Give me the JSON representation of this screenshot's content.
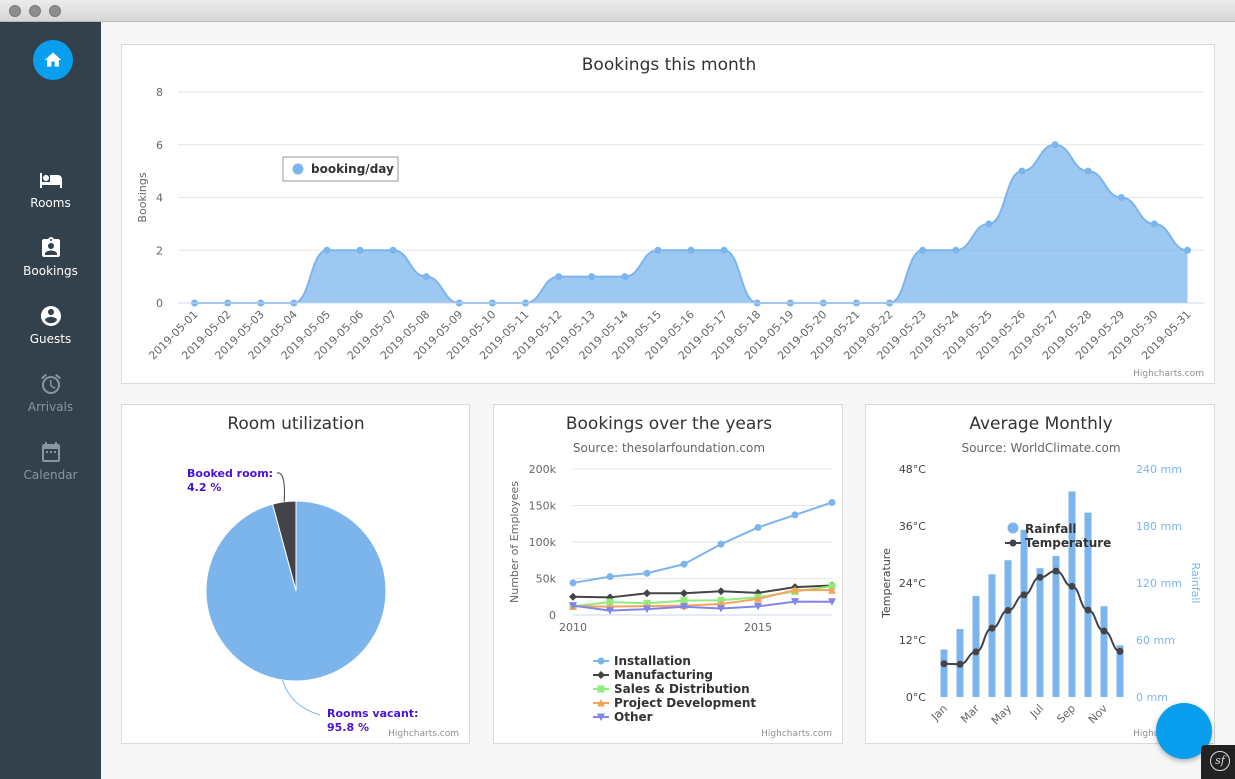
{
  "window": {
    "controls": [
      "close",
      "minimize",
      "maximize"
    ]
  },
  "sidebar": {
    "home_icon": "home-icon",
    "items": [
      {
        "label": "Rooms",
        "icon": "bed-icon",
        "active": true
      },
      {
        "label": "Bookings",
        "icon": "clipboard-icon",
        "active": true
      },
      {
        "label": "Guests",
        "icon": "account-circle-icon",
        "active": true
      },
      {
        "label": "Arrivals",
        "icon": "alarm-clock-icon",
        "active": false
      },
      {
        "label": "Calendar",
        "icon": "calendar-icon",
        "active": false
      }
    ]
  },
  "credit": "Highcharts.com",
  "colors": {
    "sidebar": "#33414c",
    "accent": "#0a9eef",
    "series_blue": "#7cb5ec",
    "dark": "#434348",
    "green": "#90ed7d",
    "orange": "#f7a35c",
    "purple": "#8085e9"
  },
  "chart_data": [
    {
      "id": "bookings_month",
      "type": "area",
      "title": "Bookings this month",
      "ylabel": "Bookings",
      "ylim": [
        0,
        8
      ],
      "yticks": [
        0,
        2,
        4,
        6,
        8
      ],
      "grid": true,
      "legend_placement": "top-left",
      "categories": [
        "2019-05-01",
        "2019-05-02",
        "2019-05-03",
        "2019-05-04",
        "2019-05-05",
        "2019-05-06",
        "2019-05-07",
        "2019-05-08",
        "2019-05-09",
        "2019-05-10",
        "2019-05-11",
        "2019-05-12",
        "2019-05-13",
        "2019-05-14",
        "2019-05-15",
        "2019-05-16",
        "2019-05-17",
        "2019-05-18",
        "2019-05-19",
        "2019-05-20",
        "2019-05-21",
        "2019-05-22",
        "2019-05-23",
        "2019-05-24",
        "2019-05-25",
        "2019-05-26",
        "2019-05-27",
        "2019-05-28",
        "2019-05-29",
        "2019-05-30",
        "2019-05-31"
      ],
      "series": [
        {
          "name": "booking/day",
          "values": [
            0,
            0,
            0,
            0,
            2,
            2,
            2,
            1,
            0,
            0,
            0,
            1,
            1,
            1,
            2,
            2,
            2,
            0,
            0,
            0,
            0,
            0,
            2,
            2,
            3,
            5,
            6,
            5,
            4,
            3,
            2
          ]
        }
      ]
    },
    {
      "id": "room_utilization",
      "type": "pie",
      "title": "Room utilization",
      "slices": [
        {
          "name": "Booked room:",
          "label": "4.2 %",
          "value": 4.2
        },
        {
          "name": "Rooms vacant:",
          "label": "95.8 %",
          "value": 95.8
        }
      ]
    },
    {
      "id": "bookings_years",
      "type": "line",
      "title": "Bookings over the years",
      "subtitle": "Source: thesolarfoundation.com",
      "ylabel": "Number of Employees",
      "ylim": [
        0,
        200000
      ],
      "yticks": [
        {
          "v": 0,
          "label": "0"
        },
        {
          "v": 50000,
          "label": "50k"
        },
        {
          "v": 100000,
          "label": "100k"
        },
        {
          "v": 150000,
          "label": "150k"
        },
        {
          "v": 200000,
          "label": "200k"
        }
      ],
      "xticks": [
        2010,
        2015
      ],
      "x": [
        2010,
        2011,
        2012,
        2013,
        2014,
        2015,
        2016,
        2017
      ],
      "legend_placement": "bottom",
      "series": [
        {
          "name": "Installation",
          "values": [
            43934,
            52503,
            57177,
            69658,
            97031,
            119931,
            137133,
            154175
          ]
        },
        {
          "name": "Manufacturing",
          "values": [
            24916,
            24064,
            29742,
            29851,
            32490,
            30282,
            38121,
            40434
          ]
        },
        {
          "name": "Sales & Distribution",
          "values": [
            11744,
            17722,
            16005,
            19771,
            20185,
            24377,
            32147,
            39387
          ]
        },
        {
          "name": "Project Development",
          "values": [
            12000,
            11500,
            12200,
            12908,
            15000,
            22000,
            34227,
            34000
          ]
        },
        {
          "name": "Other",
          "values": [
            12908,
            5948,
            8105,
            11248,
            8989,
            11816,
            18274,
            18111
          ]
        }
      ]
    },
    {
      "id": "avg_monthly",
      "type": "bar",
      "title": "Average Monthly",
      "subtitle": "Source: WorldClimate.com",
      "categories": [
        "Jan",
        "Feb",
        "Mar",
        "Apr",
        "May",
        "Jun",
        "Jul",
        "Aug",
        "Sep",
        "Oct",
        "Nov",
        "Dec"
      ],
      "x_tick_labels": [
        "Jan",
        "Mar",
        "May",
        "Jul",
        "Sep",
        "Nov"
      ],
      "y_left": {
        "label": "Temperature",
        "ticks": [
          "0°C",
          "12°C",
          "24°C",
          "36°C",
          "48°C"
        ],
        "range": [
          0,
          48
        ]
      },
      "y_right": {
        "label": "Rainfall",
        "ticks": [
          "0 mm",
          "60 mm",
          "120 mm",
          "180 mm",
          "240 mm"
        ],
        "range": [
          0,
          240
        ]
      },
      "legend_placement": "top-right",
      "series": [
        {
          "name": "Rainfall",
          "type": "column",
          "values": [
            49.9,
            71.5,
            106.4,
            129.2,
            144.0,
            176.0,
            135.6,
            148.5,
            216.4,
            194.1,
            95.6,
            54.4
          ]
        },
        {
          "name": "Temperature",
          "type": "spline",
          "values": [
            7.0,
            6.9,
            9.5,
            14.5,
            18.2,
            21.5,
            25.2,
            26.5,
            23.3,
            18.3,
            13.9,
            9.6
          ]
        }
      ]
    }
  ]
}
